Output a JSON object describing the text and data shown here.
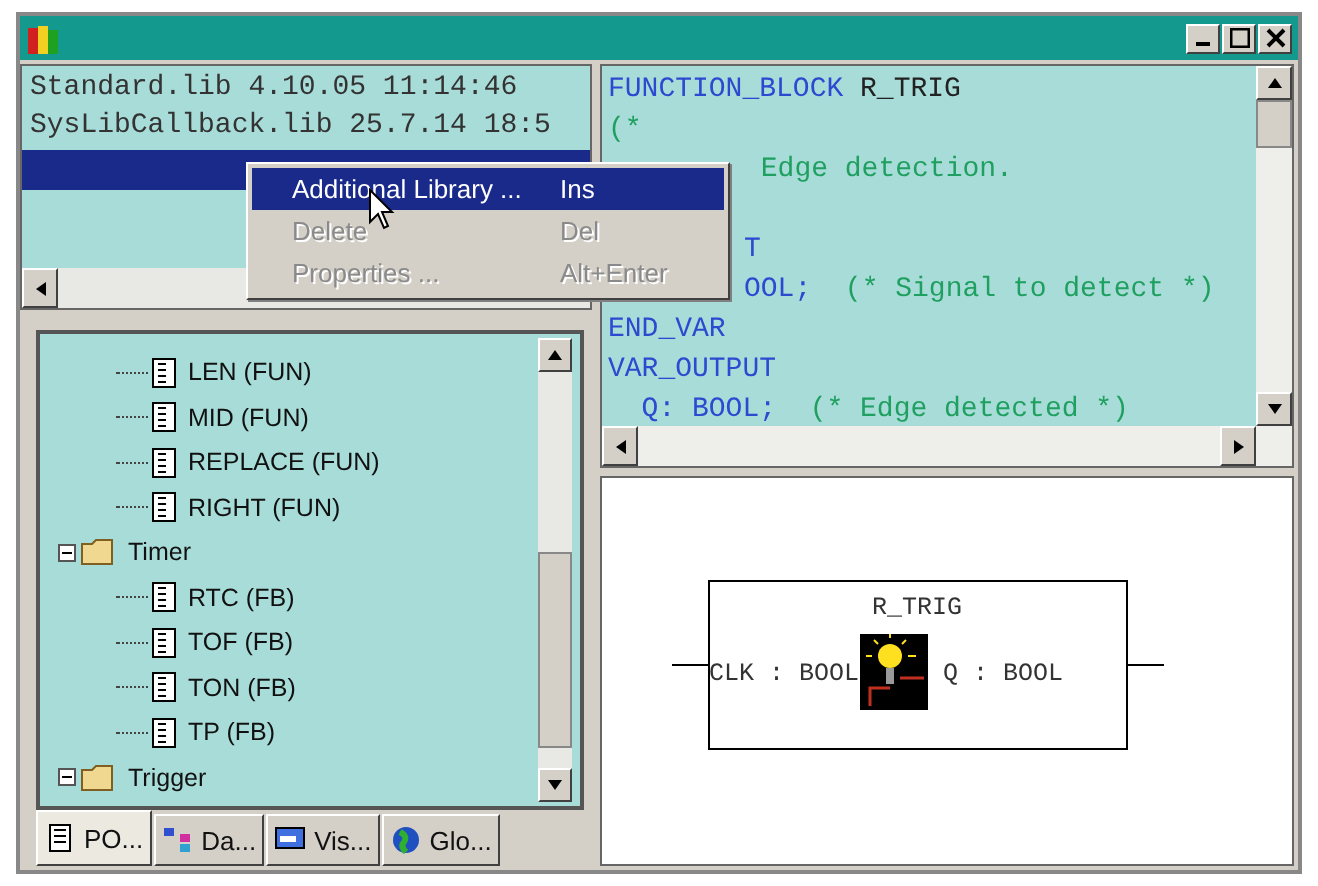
{
  "window": {
    "title_bar": {
      "buttons": [
        {
          "kind": "minimize"
        },
        {
          "kind": "maximize"
        },
        {
          "kind": "close"
        }
      ]
    }
  },
  "library_list": {
    "rows": [
      {
        "text": "Standard.lib 4.10.05 11:14:46",
        "selected": false
      },
      {
        "text": "SysLibCallback.lib 25.7.14 18:5",
        "selected": false
      },
      {
        "text": "",
        "selected": true
      }
    ]
  },
  "context_menu": {
    "items": [
      {
        "label": "Additional Library ...",
        "shortcut": "Ins",
        "selected": true,
        "disabled": false
      },
      {
        "label": "Delete",
        "shortcut": "Del",
        "selected": false,
        "disabled": true
      },
      {
        "label": "Properties ...",
        "shortcut": "Alt+Enter",
        "selected": false,
        "disabled": true
      }
    ]
  },
  "tree": {
    "items": [
      {
        "label": "LEN (FUN)",
        "kind": "pou"
      },
      {
        "label": "MID (FUN)",
        "kind": "pou"
      },
      {
        "label": "REPLACE (FUN)",
        "kind": "pou"
      },
      {
        "label": "RIGHT (FUN)",
        "kind": "pou"
      },
      {
        "label": "Timer",
        "kind": "folder",
        "expanded": true,
        "children": [
          {
            "label": "RTC (FB)",
            "kind": "pou"
          },
          {
            "label": "TOF (FB)",
            "kind": "pou"
          },
          {
            "label": "TON (FB)",
            "kind": "pou"
          },
          {
            "label": "TP (FB)",
            "kind": "pou"
          }
        ]
      },
      {
        "label": "Trigger",
        "kind": "folder",
        "expanded": true
      }
    ]
  },
  "tabs": [
    {
      "label": "PO...",
      "kind": "pou",
      "selected": true
    },
    {
      "label": "Da...",
      "kind": "data",
      "selected": false
    },
    {
      "label": "Vis...",
      "kind": "vis",
      "selected": false
    },
    {
      "label": "Glo...",
      "kind": "globe",
      "selected": false
    }
  ],
  "code": {
    "lines": [
      {
        "cut": false,
        "segments": [
          {
            "text": "FUNCTION_BLOCK",
            "kind": "keyword"
          },
          {
            "text": " R_TRIG",
            "kind": "plain"
          }
        ]
      },
      {
        "cut": false,
        "segments": [
          {
            "text": "(*",
            "kind": "comment"
          }
        ]
      },
      {
        "cut": true,
        "segments": [
          {
            "text": " Edge detection.",
            "kind": "comment"
          }
        ]
      },
      {
        "cut": true
      },
      {
        "cut": true,
        "segments": [
          {
            "text": "T",
            "kind": "keyword"
          }
        ]
      },
      {
        "cut": true,
        "segments": [
          {
            "text": "OOL;",
            "kind": "keyword"
          },
          {
            "text": "  (* Signal to detect *)",
            "kind": "comment"
          }
        ]
      },
      {
        "cut": false,
        "segments": [
          {
            "text": "END_VAR",
            "kind": "keyword"
          }
        ]
      },
      {
        "cut": false,
        "segments": [
          {
            "text": "VAR_OUTPUT",
            "kind": "keyword"
          }
        ]
      },
      {
        "cut": false,
        "segments": [
          {
            "text": "  Q: BOOL;",
            "kind": "keyword"
          },
          {
            "text": "  (* Edge detected *)",
            "kind": "comment"
          }
        ]
      }
    ]
  },
  "diagram": {
    "block": {
      "name": "R_TRIG",
      "input": "CLK : BOOL",
      "output": "Q : BOOL"
    }
  }
}
